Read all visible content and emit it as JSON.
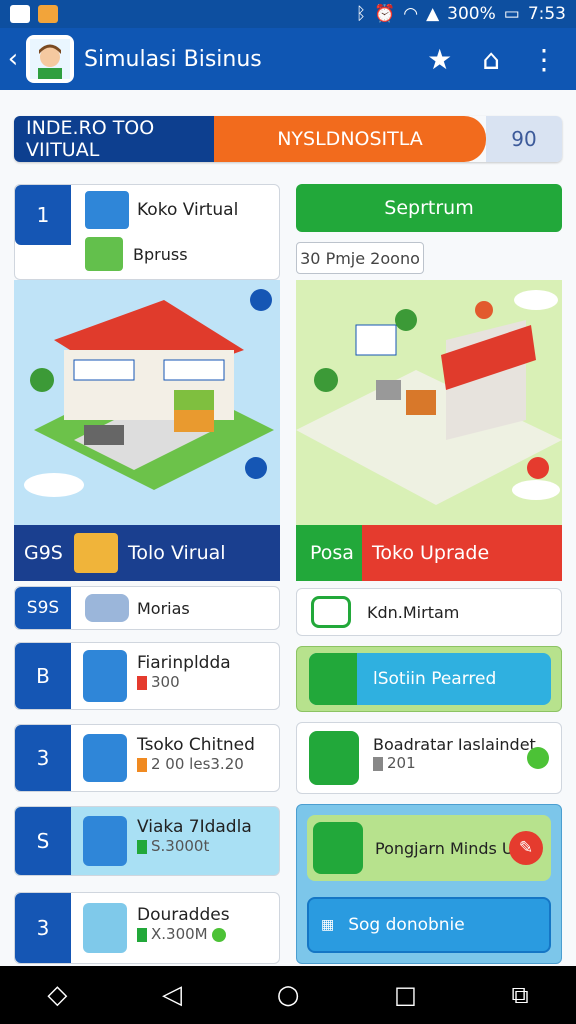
{
  "status": {
    "battery": "300%",
    "time": "7:53"
  },
  "app": {
    "title": "Simulasi Bisinus"
  },
  "banner": {
    "left": "INDE.RO TOO VIITUAL",
    "middle": "NYSLDNOSITLA",
    "right": "90"
  },
  "left": {
    "top_num": "1",
    "top_items": [
      "Koko Virtual",
      "Bpruss"
    ],
    "scene_num": "G9S",
    "scene_label": "Tolo Virual",
    "rows": [
      {
        "num": "S9S",
        "title": "Morias",
        "sub": ""
      },
      {
        "num": "B",
        "title": "Fiarinpldda",
        "sub": "300"
      },
      {
        "num": "3",
        "title": "Tsoko Chitned",
        "sub": "2 00 les3.20"
      },
      {
        "num": "S",
        "title": "Viaka 7Idadla",
        "sub": "S.3000t"
      },
      {
        "num": "3",
        "title": "Douraddes",
        "sub": "X.300M"
      }
    ]
  },
  "right": {
    "top_button": "Seprtrum",
    "top_pill": "30 Pmje 2oono",
    "scene_num": "Posa",
    "scene_label": "Toko Uprade",
    "rows": [
      {
        "title": "Kdn.Mirtam",
        "sub": ""
      },
      {
        "title": "lSotiin Pearred",
        "sub": ""
      },
      {
        "title": "Boadratar Iaslaindet",
        "sub": "201"
      },
      {
        "title": "Pongjarn Minds Ui",
        "sub": ""
      },
      {
        "title": "Sog donobnie",
        "sub": ""
      }
    ]
  },
  "colors": {
    "blue": "#1556b4",
    "green": "#22a83a",
    "orange": "#f26b1d",
    "red": "#e53b2e"
  }
}
